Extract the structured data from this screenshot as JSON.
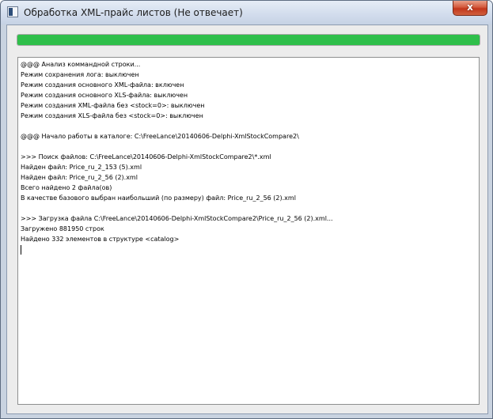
{
  "window": {
    "title": "Обработка XML-прайс листов (Не отвечает)",
    "close_label": "x"
  },
  "progress": {
    "value": 1.0,
    "color": "#2fbf4a"
  },
  "log": {
    "lines": [
      "@@@ Анализ коммандной строки...",
      "Режим сохранения лога: выключен",
      "Режим создания основного XML-файла: включен",
      "Режим создания основного XLS-файла: выключен",
      "Режим создания XML-файла без <stock=0>: выключен",
      "Режим создания XLS-файла без <stock=0>: выключен",
      "",
      "@@@ Начало работы в каталоге: C:\\FreeLance\\20140606-Delphi-XmlStockCompare2\\",
      "",
      ">>> Поиск файлов: C:\\FreeLance\\20140606-Delphi-XmlStockCompare2\\*.xml",
      "Найден файл: Price_ru_2_153 (5).xml",
      "Найден файл: Price_ru_2_56 (2).xml",
      "Всего найдено 2 файла(ов)",
      "В качестве базового выбран наибольший (по размеру) файл: Price_ru_2_56 (2).xml",
      "",
      ">>> Загрузка файла C:\\FreeLance\\20140606-Delphi-XmlStockCompare2\\Price_ru_2_56 (2).xml...",
      "Загружено 881950 строк",
      "Найдено 332 элементов в структуре <catalog>"
    ]
  }
}
